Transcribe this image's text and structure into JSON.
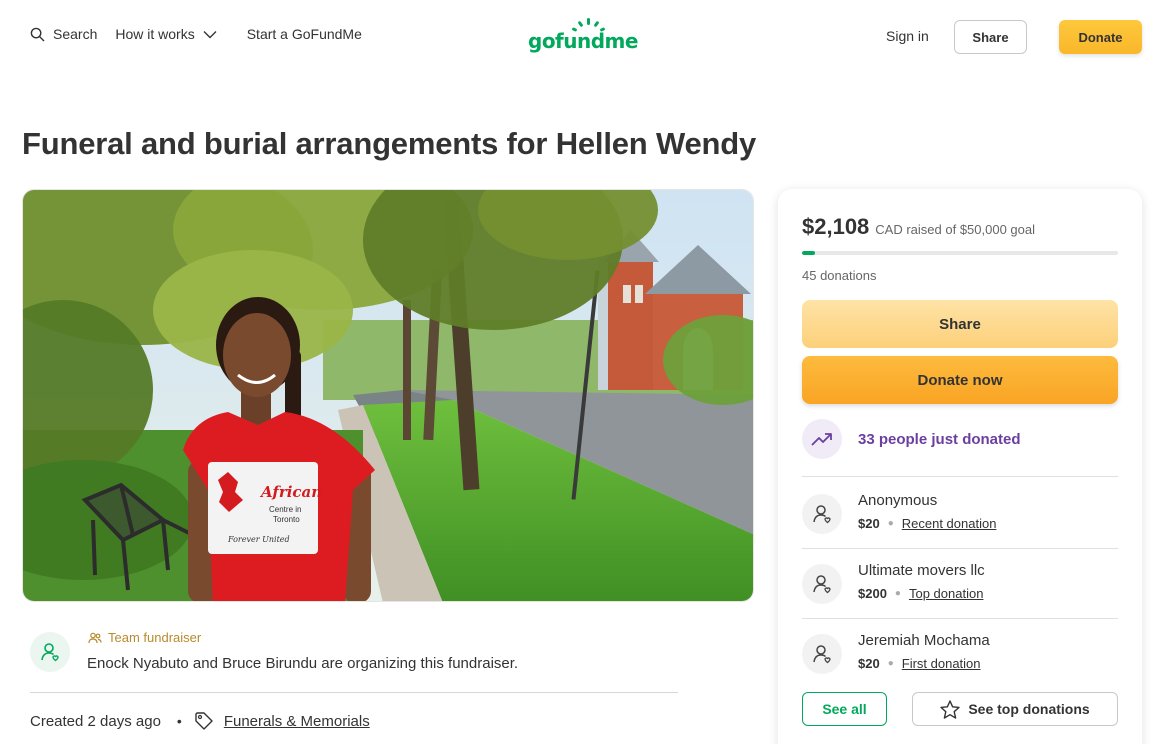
{
  "header": {
    "search_label": "Search",
    "how_it_works_label": "How it works",
    "start_label": "Start a GoFundMe",
    "logo_text": "gofundme",
    "sign_in_label": "Sign in",
    "share_label": "Share",
    "donate_label": "Donate"
  },
  "page": {
    "title": "Funeral and burial arrangements for Hellen Wendy"
  },
  "hero": {
    "shirt_line1": "African",
    "shirt_line2": "Centre in",
    "shirt_line3": "Toronto",
    "shirt_line4": "Forever United"
  },
  "organizer": {
    "team_label": "Team fundraiser",
    "text": "Enock Nyabuto and Bruce Birundu are organizing this fundraiser.",
    "created": "Created 2 days ago",
    "category": "Funerals & Memorials"
  },
  "donation_card": {
    "raised_amount": "$2,108",
    "raised_sub": "CAD raised of $50,000 goal",
    "progress_fraction": 0.04216,
    "donations_count": "45 donations",
    "share_label": "Share",
    "donate_label": "Donate now",
    "trend_text": "33 people just donated",
    "donors": [
      {
        "name": "Anonymous",
        "amount": "$20",
        "type": "Recent donation"
      },
      {
        "name": "Ultimate movers llc",
        "amount": "$200",
        "type": "Top donation"
      },
      {
        "name": "Jeremiah Mochama",
        "amount": "$20",
        "type": "First donation"
      }
    ],
    "see_all_label": "See all",
    "see_top_label": "See top donations"
  },
  "colors": {
    "brand_green": "#02a95c",
    "donate_orange": "#f9a424",
    "share_yellow": "#fcd07a",
    "trend_purple": "#6b3fa0"
  }
}
